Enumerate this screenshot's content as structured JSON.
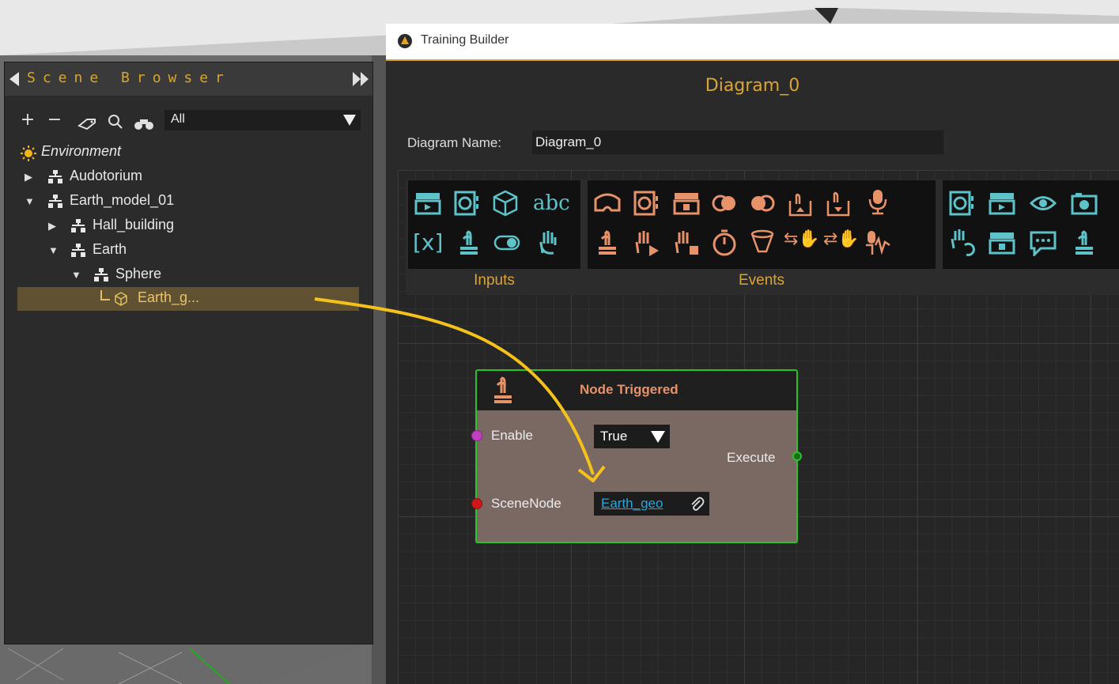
{
  "scene_browser": {
    "title": "Scene Browser",
    "filter": {
      "value": "All"
    },
    "toolbar_icons": [
      "add-icon",
      "remove-icon",
      "tag-icon",
      "search-icon",
      "binoculars-icon"
    ],
    "tree": [
      {
        "label": "Environment",
        "type": "environment",
        "level": 0
      },
      {
        "label": "Audotorium",
        "type": "group",
        "level": 0,
        "expanded": false
      },
      {
        "label": "Earth_model_01",
        "type": "group",
        "level": 0,
        "expanded": true
      },
      {
        "label": "Hall_building",
        "type": "group",
        "level": 1,
        "expanded": false
      },
      {
        "label": "Earth",
        "type": "group",
        "level": 1,
        "expanded": true
      },
      {
        "label": "Sphere",
        "type": "group",
        "level": 2,
        "expanded": true
      },
      {
        "label": "Earth_g...",
        "type": "geometry",
        "level": 3,
        "selected": true
      }
    ]
  },
  "training_builder": {
    "window_title": "Training Builder",
    "diagram_title": "Diagram_0",
    "diagram_name_label": "Diagram Name:",
    "diagram_name_value": "Diagram_0",
    "palette": {
      "inputs_label": "Inputs",
      "events_label": "Events"
    },
    "node": {
      "title": "Node Triggered",
      "enable_label": "Enable",
      "enable_value": "True",
      "execute_label": "Execute",
      "scenenode_label": "SceneNode",
      "scenenode_value": "Earth_geo"
    }
  },
  "colors": {
    "accent": "#d9a534",
    "teal": "#5ec3c9",
    "salmon": "#e8926a",
    "node_border": "#27c427",
    "link": "#27a8e0"
  }
}
